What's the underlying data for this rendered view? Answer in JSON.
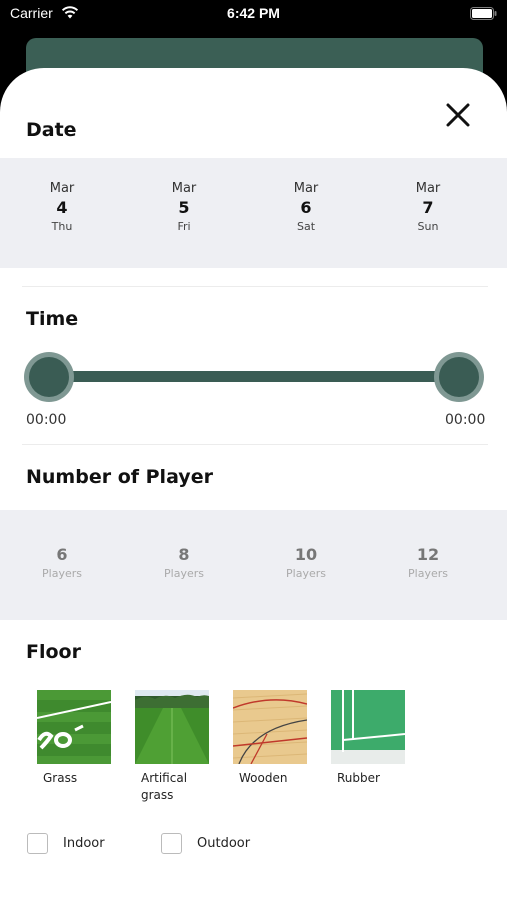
{
  "status_bar": {
    "carrier": "Carrier",
    "time": "6:42 PM"
  },
  "sheet": {
    "date_section": {
      "title": "Date",
      "dates": [
        {
          "month": "Mar",
          "day": "4",
          "weekday": "Thu"
        },
        {
          "month": "Mar",
          "day": "5",
          "weekday": "Fri"
        },
        {
          "month": "Mar",
          "day": "6",
          "weekday": "Sat"
        },
        {
          "month": "Mar",
          "day": "7",
          "weekday": "Sun"
        }
      ]
    },
    "time_section": {
      "title": "Time",
      "start": "00:00",
      "end": "00:00"
    },
    "players_section": {
      "title": "Number of Player",
      "options": [
        {
          "count": "6",
          "unit": "Players"
        },
        {
          "count": "8",
          "unit": "Players"
        },
        {
          "count": "10",
          "unit": "Players"
        },
        {
          "count": "12",
          "unit": "Players"
        }
      ]
    },
    "floor_section": {
      "title": "Floor",
      "options": [
        {
          "label": "Grass",
          "image": "grass-field-photo"
        },
        {
          "label": "Artifical grass",
          "image": "artificial-grass-field-photo"
        },
        {
          "label": "Wooden",
          "image": "wooden-court-photo"
        },
        {
          "label": "Rubber",
          "image": "rubber-court-photo"
        }
      ],
      "venue_types": [
        {
          "label": "Indoor",
          "checked": false
        },
        {
          "label": "Outdoor",
          "checked": false
        }
      ]
    }
  },
  "icons": {
    "close": "close-icon",
    "wifi": "wifi-icon",
    "battery": "battery-icon"
  },
  "colors": {
    "accent": "#3a5c54",
    "strip_bg": "#eeeff3"
  }
}
